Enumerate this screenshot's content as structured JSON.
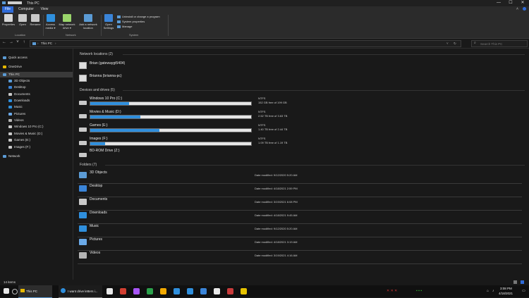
{
  "window": {
    "title": "This PC",
    "minimize": "—",
    "maximize": "☐",
    "close": "✕"
  },
  "ribbon_tabs": [
    "File",
    "Computer",
    "View"
  ],
  "ribbon": {
    "location_buttons": [
      "Properties",
      "Open",
      "Rename"
    ],
    "network_buttons": [
      "Access media ▾",
      "Map network drive ▾",
      "Add a network location"
    ],
    "open_settings": "Open Settings",
    "system_links": [
      "Uninstall or change a program",
      "System properties",
      "Manage"
    ],
    "groups": [
      "Location",
      "Network",
      "System"
    ]
  },
  "address": {
    "back": "←",
    "forward": "→",
    "recent": "˅",
    "up": "↑",
    "path": "This PC",
    "search_placeholder": "Search This PC"
  },
  "nav": [
    {
      "label": "Quick access",
      "icon": "star-icon",
      "color": "#5b9bd5"
    },
    {
      "label": "OneDrive",
      "icon": "cloud-icon",
      "color": "#e6b800"
    },
    {
      "label": "This PC",
      "icon": "computer-icon",
      "color": "#5b9bd5"
    },
    {
      "label": "3D Objects",
      "icon": "cube-icon",
      "color": "#5b9bd5"
    },
    {
      "label": "Desktop",
      "icon": "desktop-icon",
      "color": "#3a84d8"
    },
    {
      "label": "Documents",
      "icon": "document-icon",
      "color": "#c9c9c9"
    },
    {
      "label": "Downloads",
      "icon": "download-icon",
      "color": "#2f8fdd"
    },
    {
      "label": "Music",
      "icon": "music-icon",
      "color": "#2f8fdd"
    },
    {
      "label": "Pictures",
      "icon": "pictures-icon",
      "color": "#6aa9e8"
    },
    {
      "label": "Videos",
      "icon": "videos-icon",
      "color": "#b5b5b5"
    },
    {
      "label": "Windows 10 Pro (C:)",
      "icon": "drive-icon",
      "color": "#c9c9c9"
    },
    {
      "label": "Movies & Music (D:)",
      "icon": "drive-icon",
      "color": "#c9c9c9"
    },
    {
      "label": "Games (E:)",
      "icon": "drive-icon",
      "color": "#c9c9c9"
    },
    {
      "label": "Images (F:)",
      "icon": "drive-icon",
      "color": "#c9c9c9"
    },
    {
      "label": "Network",
      "icon": "network-icon",
      "color": "#5b9bd5"
    }
  ],
  "groups": {
    "network": "Network locations (2)",
    "devices": "Devices and drives (5)",
    "folders": "Folders (7)"
  },
  "network_locations": [
    "Brian (gatewaygt5404)",
    "Brianna (brianna-pc)"
  ],
  "drives": [
    {
      "name": "Windows 10 Pro (C:)",
      "fs": "NTFS",
      "free": "152 GB free of 199 GB",
      "used_fraction": 0.24
    },
    {
      "name": "Movies & Music (D:)",
      "fs": "NTFS",
      "free": "2.52 TB free of 3.63 TB",
      "used_fraction": 0.31
    },
    {
      "name": "Games (E:)",
      "fs": "NTFS",
      "free": "1.40 TB free of 2.44 TB",
      "used_fraction": 0.43
    },
    {
      "name": "Images (F:)",
      "fs": "NTFS",
      "free": "1.09 TB free of 1.19 TB",
      "used_fraction": 0.09
    }
  ],
  "bdrom": {
    "name": "BD-ROM Drive (Z:)"
  },
  "folders": [
    {
      "name": "3D Objects",
      "date": "Date modified: 9/12/2020 5:20 AM",
      "icon": "cube-icon",
      "color": "#5b9bd5"
    },
    {
      "name": "Desktop",
      "date": "Date modified: 4/18/2021 2:59 PM",
      "icon": "desktop-icon",
      "color": "#3a84d8"
    },
    {
      "name": "Documents",
      "date": "Date modified: 3/19/2021 6:08 PM",
      "icon": "document-icon",
      "color": "#c9c9c9"
    },
    {
      "name": "Downloads",
      "date": "Date modified: 4/18/2021 9:45 AM",
      "icon": "download-icon",
      "color": "#2f8fdd"
    },
    {
      "name": "Music",
      "date": "Date modified: 9/12/2020 5:20 AM",
      "icon": "music-icon",
      "color": "#2f8fdd"
    },
    {
      "name": "Pictures",
      "date": "Date modified: 4/18/2021 3:19 AM",
      "icon": "pictures-icon",
      "color": "#6aa9e8"
    },
    {
      "name": "Videos",
      "date": "Date modified: 3/19/2021 4:16 AM",
      "icon": "videos-icon",
      "color": "#b5b5b5"
    }
  ],
  "status": {
    "items": "14 items"
  },
  "taskbar": {
    "explorer_label": "This PC",
    "browser_label": "I want drive letters i...",
    "clock_time": "3:08 PM",
    "clock_date": "4/18/2021",
    "app_colors": [
      "#e8e8e8",
      "#d23f31",
      "#a855f7",
      "#2ba14b",
      "#f2a900",
      "#2f8fdd",
      "#2f8fdd",
      "#3a84d8",
      "#e8e8e8",
      "#c93b3b",
      "#e6c200"
    ]
  }
}
